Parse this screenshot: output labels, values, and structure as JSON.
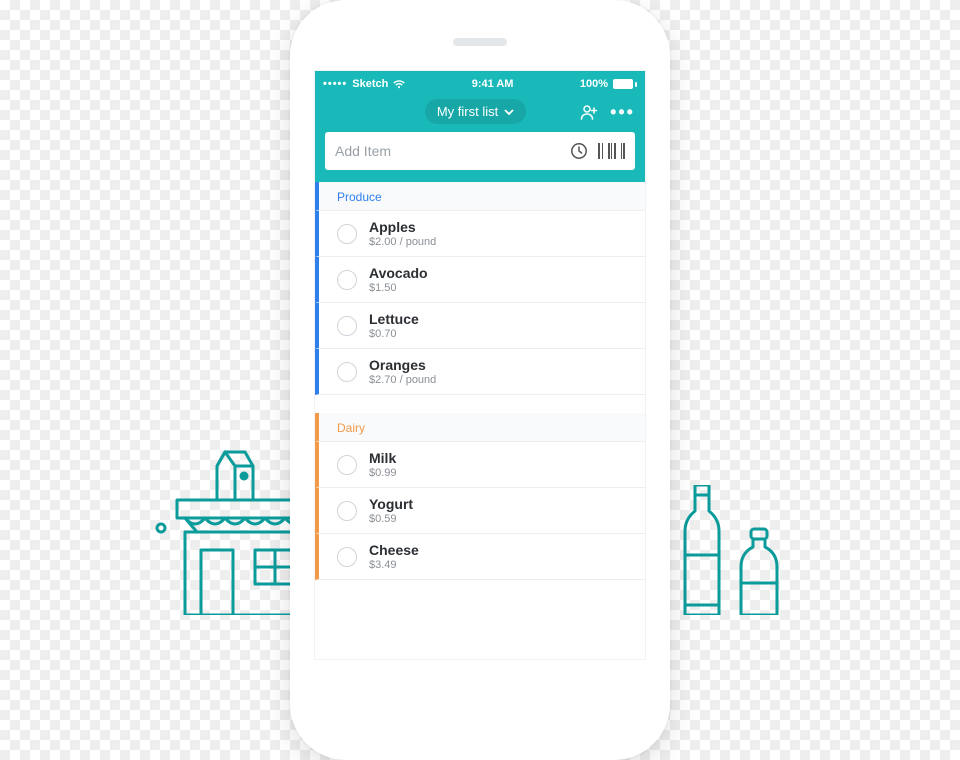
{
  "statusbar": {
    "carrier": "Sketch",
    "time": "9:41 AM",
    "battery_pct": "100%"
  },
  "navbar": {
    "list_title": "My first list"
  },
  "search": {
    "placeholder": "Add Item"
  },
  "colors": {
    "teal": "#19b9b9",
    "produce": "#2f80ed",
    "dairy": "#f2994a"
  },
  "sections": [
    {
      "id": "produce",
      "label": "Produce",
      "color_key": "produce",
      "items": [
        {
          "name": "Apples",
          "price": "$2.00 / pound"
        },
        {
          "name": "Avocado",
          "price": "$1.50"
        },
        {
          "name": "Lettuce",
          "price": "$0.70"
        },
        {
          "name": "Oranges",
          "price": "$2.70 / pound"
        }
      ]
    },
    {
      "id": "dairy",
      "label": "Dairy",
      "color_key": "dairy",
      "items": [
        {
          "name": "Milk",
          "price": "$0.99"
        },
        {
          "name": "Yogurt",
          "price": "$0.59"
        },
        {
          "name": "Cheese",
          "price": "$3.49"
        }
      ]
    }
  ]
}
